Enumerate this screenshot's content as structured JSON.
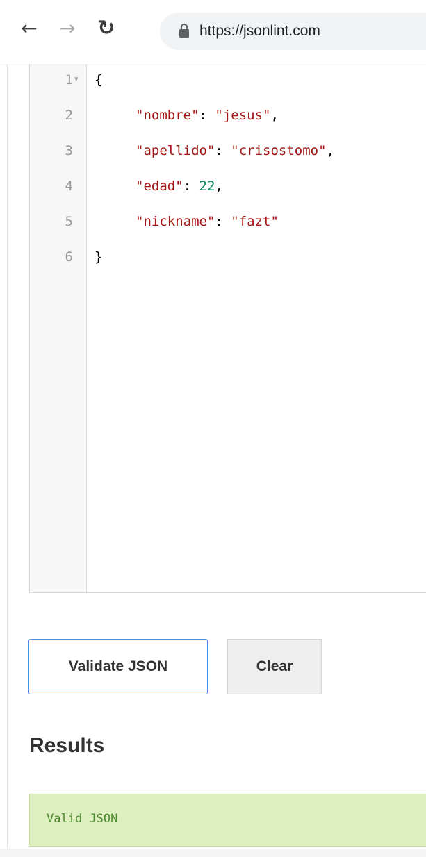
{
  "browser": {
    "url": "https://jsonlint.com",
    "icons": {
      "back": "arrow-left-icon",
      "forward": "arrow-right-icon",
      "reload": "reload-icon",
      "lock": "lock-icon"
    }
  },
  "editor": {
    "lines": [
      {
        "number": "1",
        "fold": "▾",
        "text": "{"
      },
      {
        "number": "2",
        "key": "\"nombre\"",
        "value": "\"jesus\"",
        "value_type": "string",
        "trail": ","
      },
      {
        "number": "3",
        "key": "\"apellido\"",
        "value": "\"crisostomo\"",
        "value_type": "string",
        "trail": ","
      },
      {
        "number": "4",
        "key": "\"edad\"",
        "value": "22",
        "value_type": "number",
        "trail": ","
      },
      {
        "number": "5",
        "key": "\"nickname\"",
        "value": "\"fazt\"",
        "value_type": "string",
        "trail": ""
      },
      {
        "number": "6",
        "text": "}"
      }
    ]
  },
  "actions": {
    "validate_label": "Validate JSON",
    "clear_label": "Clear"
  },
  "results": {
    "title": "Results",
    "message": "Valid JSON"
  },
  "colors": {
    "string": "#a31515",
    "number": "#098658",
    "valid_bg": "#dff0c0",
    "valid_text": "#4d8a2f",
    "validate_border": "#4a90e2"
  }
}
